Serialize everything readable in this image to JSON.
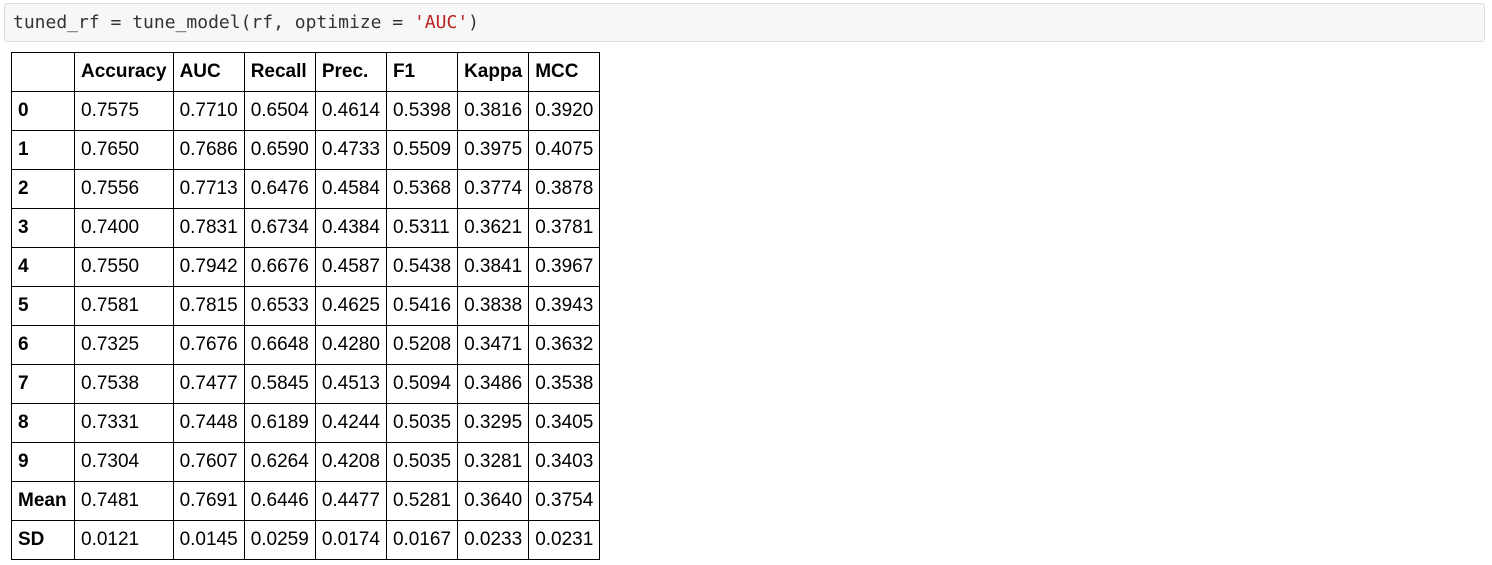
{
  "code": {
    "segments": [
      {
        "text": "tuned_rf = tune_model(rf, optimize = ",
        "kind": "plain"
      },
      {
        "text": "'AUC'",
        "kind": "string"
      },
      {
        "text": ")",
        "kind": "plain"
      }
    ]
  },
  "table": {
    "corner": "",
    "columns": [
      "Accuracy",
      "AUC",
      "Recall",
      "Prec.",
      "F1",
      "Kappa",
      "MCC"
    ],
    "rows": [
      {
        "index": "0",
        "values": [
          "0.7575",
          "0.7710",
          "0.6504",
          "0.4614",
          "0.5398",
          "0.3816",
          "0.3920"
        ]
      },
      {
        "index": "1",
        "values": [
          "0.7650",
          "0.7686",
          "0.6590",
          "0.4733",
          "0.5509",
          "0.3975",
          "0.4075"
        ]
      },
      {
        "index": "2",
        "values": [
          "0.7556",
          "0.7713",
          "0.6476",
          "0.4584",
          "0.5368",
          "0.3774",
          "0.3878"
        ]
      },
      {
        "index": "3",
        "values": [
          "0.7400",
          "0.7831",
          "0.6734",
          "0.4384",
          "0.5311",
          "0.3621",
          "0.3781"
        ]
      },
      {
        "index": "4",
        "values": [
          "0.7550",
          "0.7942",
          "0.6676",
          "0.4587",
          "0.5438",
          "0.3841",
          "0.3967"
        ]
      },
      {
        "index": "5",
        "values": [
          "0.7581",
          "0.7815",
          "0.6533",
          "0.4625",
          "0.5416",
          "0.3838",
          "0.3943"
        ]
      },
      {
        "index": "6",
        "values": [
          "0.7325",
          "0.7676",
          "0.6648",
          "0.4280",
          "0.5208",
          "0.3471",
          "0.3632"
        ]
      },
      {
        "index": "7",
        "values": [
          "0.7538",
          "0.7477",
          "0.5845",
          "0.4513",
          "0.5094",
          "0.3486",
          "0.3538"
        ]
      },
      {
        "index": "8",
        "values": [
          "0.7331",
          "0.7448",
          "0.6189",
          "0.4244",
          "0.5035",
          "0.3295",
          "0.3405"
        ]
      },
      {
        "index": "9",
        "values": [
          "0.7304",
          "0.7607",
          "0.6264",
          "0.4208",
          "0.5035",
          "0.3281",
          "0.3403"
        ]
      },
      {
        "index": "Mean",
        "values": [
          "0.7481",
          "0.7691",
          "0.6446",
          "0.4477",
          "0.5281",
          "0.3640",
          "0.3754"
        ]
      },
      {
        "index": "SD",
        "values": [
          "0.0121",
          "0.0145",
          "0.0259",
          "0.0174",
          "0.0167",
          "0.0233",
          "0.0231"
        ]
      }
    ]
  },
  "colors": {
    "code_background": "#f7f7f7",
    "code_border": "#dcdcdc",
    "string_literal": "#ba2121",
    "code_text": "#333333",
    "table_border": "#000000"
  }
}
